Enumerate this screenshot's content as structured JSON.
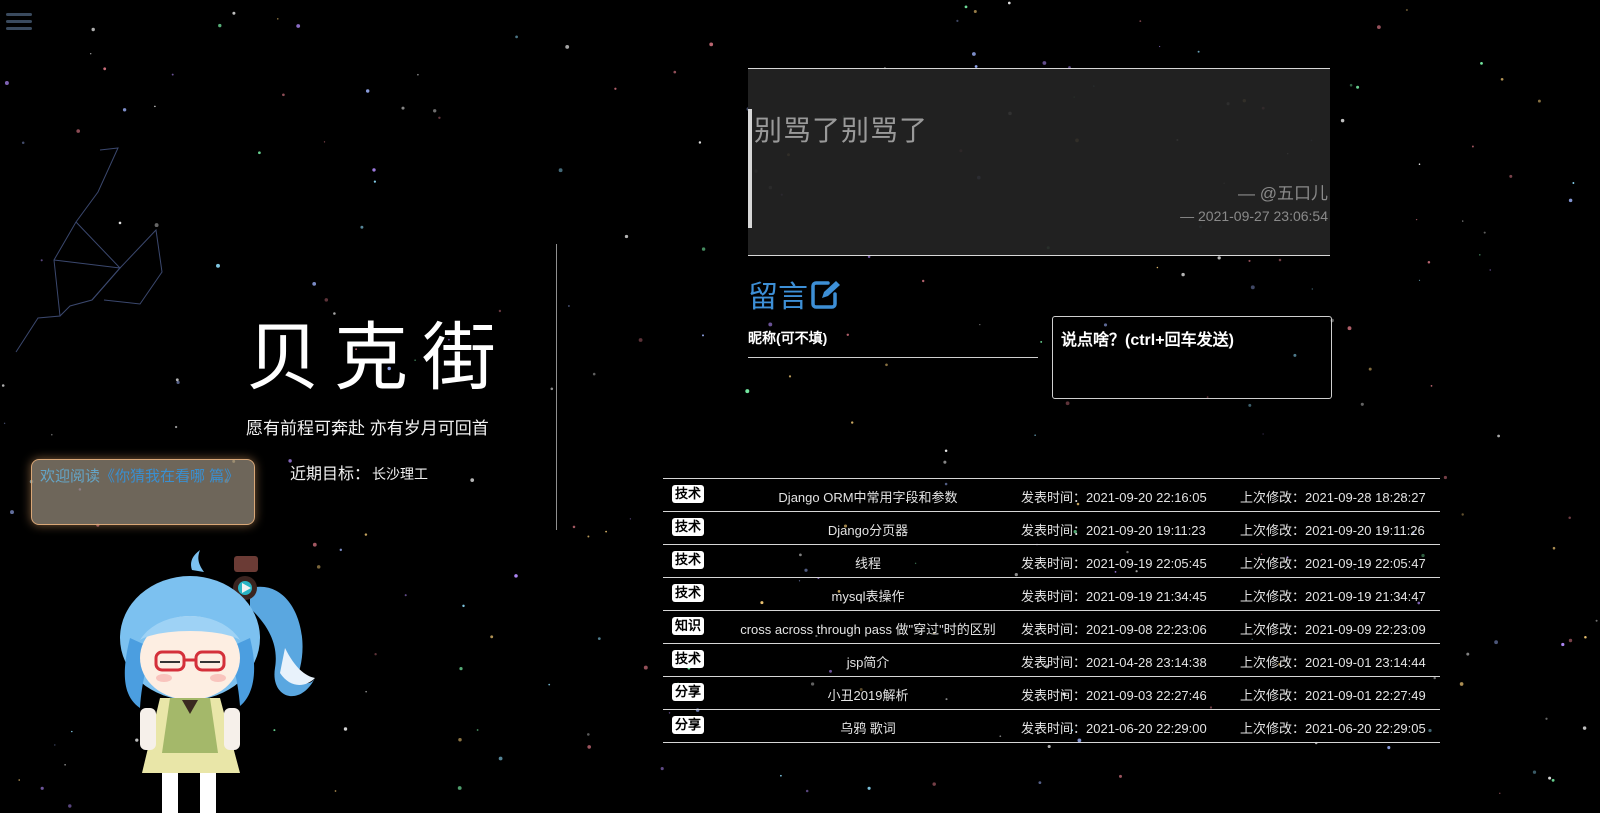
{
  "site": {
    "title": "贝克街",
    "motto": "愿有前程可奔赴 亦有岁月可回首",
    "goal_label": "近期目标：",
    "goal_value": "长沙理工"
  },
  "welcome": {
    "prefix": "欢迎阅读",
    "highlight": "《你猜我在看哪 篇》"
  },
  "quote": {
    "text": "别骂了别骂了",
    "author": "— @五口儿",
    "time": "— 2021-09-27 23:06:54"
  },
  "guestbook": {
    "title": "留言",
    "nickname_label": "昵称(可不填)",
    "message_placeholder": "说点啥？(ctrl+回车发送)"
  },
  "articles": [
    {
      "tag": "技术",
      "title": "Django ORM中常用字段和参数",
      "pub_label": "发表时间：",
      "pub": "2021-09-20 22:16:05",
      "mod_label": "上次修改：",
      "mod": "2021-09-28 18:28:27"
    },
    {
      "tag": "技术",
      "title": "Django分页器",
      "pub_label": "发表时间：",
      "pub": "2021-09-20 19:11:23",
      "mod_label": "上次修改：",
      "mod": "2021-09-20 19:11:26"
    },
    {
      "tag": "技术",
      "title": "线程",
      "pub_label": "发表时间：",
      "pub": "2021-09-19 22:05:45",
      "mod_label": "上次修改：",
      "mod": "2021-09-19 22:05:47"
    },
    {
      "tag": "技术",
      "title": "mysql表操作",
      "pub_label": "发表时间：",
      "pub": "2021-09-19 21:34:45",
      "mod_label": "上次修改：",
      "mod": "2021-09-19 21:34:47"
    },
    {
      "tag": "知识",
      "title": "cross across through pass 做\"穿过\"时的区别",
      "pub_label": "发表时间：",
      "pub": "2021-09-08 22:23:06",
      "mod_label": "上次修改：",
      "mod": "2021-09-09 22:23:09"
    },
    {
      "tag": "技术",
      "title": "jsp简介",
      "pub_label": "发表时间：",
      "pub": "2021-04-28 23:14:38",
      "mod_label": "上次修改：",
      "mod": "2021-09-01 23:14:44"
    },
    {
      "tag": "分享",
      "title": "小丑2019解析",
      "pub_label": "发表时间：",
      "pub": "2021-09-03 22:27:46",
      "mod_label": "上次修改：",
      "mod": "2021-09-01 22:27:49"
    },
    {
      "tag": "分享",
      "title": "乌鸦 歌词",
      "pub_label": "发表时间：",
      "pub": "2021-06-20 22:29:00",
      "mod_label": "上次修改：",
      "mod": "2021-06-20 22:29:05"
    }
  ],
  "icons": {
    "menu": "hamburger-menu-icon",
    "edit": "edit-icon",
    "mascot": "anime-mascot"
  },
  "colors": {
    "background": "#000000",
    "accent_blue": "#3d8fd6",
    "card_bg": "#242424",
    "welcome_border": "#d9a777",
    "tag_bg": "#ffffff"
  }
}
